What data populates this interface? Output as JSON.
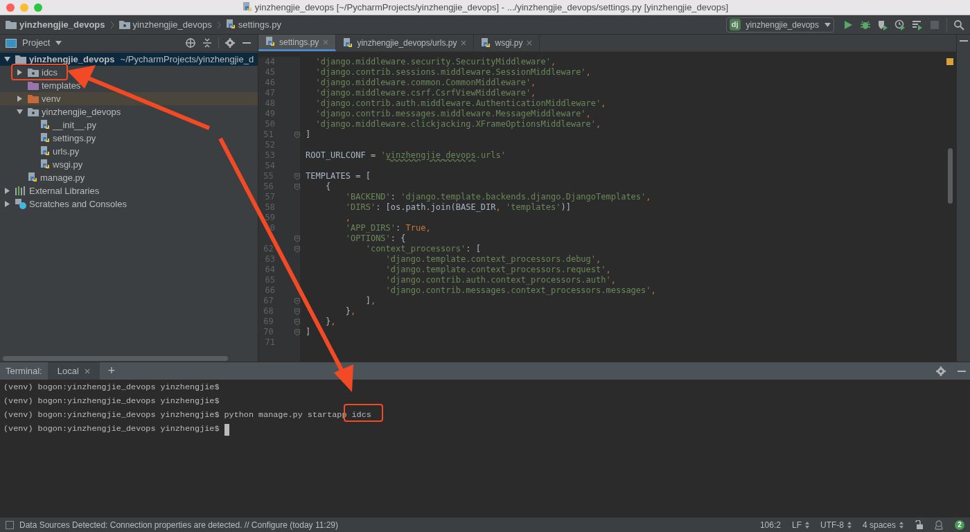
{
  "window": {
    "title": "yinzhengjie_devops [~/PycharmProjects/yinzhengjie_devops] - .../yinzhengjie_devops/settings.py [yinzhengjie_devops]"
  },
  "breadcrumbs": [
    {
      "kind": "project",
      "label": "yinzhengjie_devops"
    },
    {
      "kind": "package",
      "label": "yinzhengjie_devops"
    },
    {
      "kind": "python",
      "label": "settings.py"
    }
  ],
  "run_config": {
    "badge": "dj",
    "label": "yinzhengjie_devops"
  },
  "project_panel": {
    "title": "Project",
    "tree": [
      {
        "kind": "project",
        "label": "yinzhengjie_devops",
        "path": "~/PycharmProjects/yinzhengjie_d",
        "expanded": true,
        "selected": true,
        "children": [
          {
            "kind": "package",
            "label": "idcs",
            "expanded": false,
            "selected": false
          },
          {
            "kind": "templates",
            "label": "templates",
            "selected": false
          },
          {
            "kind": "excluded",
            "label": "venv",
            "expanded": false,
            "selected": false
          },
          {
            "kind": "package",
            "label": "yinzhengjie_devops",
            "expanded": true,
            "selected": false,
            "children": [
              {
                "kind": "python",
                "label": "__init__.py",
                "selected": false
              },
              {
                "kind": "python",
                "label": "settings.py",
                "selected": false
              },
              {
                "kind": "python",
                "label": "urls.py",
                "selected": false
              },
              {
                "kind": "python",
                "label": "wsgi.py",
                "selected": false
              }
            ]
          },
          {
            "kind": "python",
            "label": "manage.py",
            "selected": false
          }
        ]
      },
      {
        "kind": "libraries",
        "label": "External Libraries",
        "expanded": false,
        "selected": false
      },
      {
        "kind": "scratches",
        "label": "Scratches and Consoles",
        "expanded": false,
        "selected": false
      }
    ]
  },
  "editor": {
    "tabs": [
      {
        "label": "settings.py",
        "selected": true
      },
      {
        "label": "yinzhengjie_devops/urls.py",
        "selected": false
      },
      {
        "label": "wsgi.py",
        "selected": false
      }
    ],
    "lines": [
      {
        "number": "44",
        "fold": false,
        "tokens": [
          {
            "kind": "string",
            "text": "  'django.middleware.security.SecurityMiddleware'"
          },
          {
            "kind": "keyword",
            "text": ","
          }
        ]
      },
      {
        "number": "45",
        "fold": false,
        "tokens": [
          {
            "kind": "string",
            "text": "  'django.contrib.sessions.middleware.SessionMiddleware'"
          },
          {
            "kind": "keyword",
            "text": ","
          }
        ]
      },
      {
        "number": "46",
        "fold": false,
        "tokens": [
          {
            "kind": "string",
            "text": "  'django.middleware.common.CommonMiddleware'"
          },
          {
            "kind": "keyword",
            "text": ","
          }
        ]
      },
      {
        "number": "47",
        "fold": false,
        "tokens": [
          {
            "kind": "string",
            "text": "  'django.middleware.csrf.CsrfViewMiddleware'"
          },
          {
            "kind": "keyword",
            "text": ","
          }
        ]
      },
      {
        "number": "48",
        "fold": false,
        "tokens": [
          {
            "kind": "string",
            "text": "  'django.contrib.auth.middleware.AuthenticationMiddleware'"
          },
          {
            "kind": "keyword",
            "text": ","
          }
        ]
      },
      {
        "number": "49",
        "fold": false,
        "tokens": [
          {
            "kind": "string",
            "text": "  'django.contrib.messages.middleware.MessageMiddleware'"
          },
          {
            "kind": "keyword",
            "text": ","
          }
        ]
      },
      {
        "number": "50",
        "fold": false,
        "tokens": [
          {
            "kind": "string",
            "text": "  'django.middleware.clickjacking.XFrameOptionsMiddleware'"
          },
          {
            "kind": "keyword",
            "text": ","
          }
        ]
      },
      {
        "number": "51",
        "fold": true,
        "tokens": [
          {
            "kind": "plain",
            "text": "]"
          }
        ]
      },
      {
        "number": "52",
        "fold": false
      },
      {
        "number": "53",
        "fold": false,
        "tokens": [
          {
            "kind": "plain",
            "text": "ROOT_URLCONF = "
          },
          {
            "kind": "string",
            "text": "'"
          },
          {
            "kind": "typo",
            "text": "yinzhengjie_devops"
          },
          {
            "kind": "string",
            "text": ".urls'"
          }
        ]
      },
      {
        "number": "54",
        "fold": false
      },
      {
        "number": "55",
        "fold": true,
        "tokens": [
          {
            "kind": "plain",
            "text": "TEMPLATES = ["
          }
        ]
      },
      {
        "number": "56",
        "fold": true,
        "tokens": [
          {
            "kind": "plain",
            "text": "    {"
          }
        ]
      },
      {
        "number": "57",
        "fold": false,
        "tokens": [
          {
            "kind": "string",
            "text": "        'BACKEND'"
          },
          {
            "kind": "plain",
            "text": ": "
          },
          {
            "kind": "string",
            "text": "'django.template.backends.django.DjangoTemplates'"
          },
          {
            "kind": "keyword",
            "text": ","
          }
        ]
      },
      {
        "number": "58",
        "fold": false,
        "tokens": [
          {
            "kind": "string",
            "text": "        'DIRS'"
          },
          {
            "kind": "plain",
            "text": ": [os.path.join(BASE_DIR"
          },
          {
            "kind": "keyword",
            "text": ","
          },
          {
            "kind": "string",
            "text": " 'templates'"
          },
          {
            "kind": "plain",
            "text": ")]"
          }
        ]
      },
      {
        "number": "59",
        "fold": false,
        "tokens": [
          {
            "kind": "keyword",
            "text": "        ,"
          }
        ]
      },
      {
        "number": "0",
        "fold": false,
        "tokens": [
          {
            "kind": "string",
            "text": "        'APP_DIRS'"
          },
          {
            "kind": "plain",
            "text": ": "
          },
          {
            "kind": "keyword",
            "text": "True,"
          }
        ]
      },
      {
        "fold": true,
        "tokens": [
          {
            "kind": "string",
            "text": "        'OPTIONS'"
          },
          {
            "kind": "plain",
            "text": ": {"
          }
        ]
      },
      {
        "number": "62",
        "fold": true,
        "tokens": [
          {
            "kind": "string",
            "text": "            'context_processors'"
          },
          {
            "kind": "plain",
            "text": ": ["
          }
        ]
      },
      {
        "number": "63",
        "fold": false,
        "tokens": [
          {
            "kind": "string",
            "text": "                'django.template.context_processors.debug'"
          },
          {
            "kind": "keyword",
            "text": ","
          }
        ]
      },
      {
        "number": "64",
        "fold": false,
        "tokens": [
          {
            "kind": "string",
            "text": "                'django.template.context_processors.request'"
          },
          {
            "kind": "keyword",
            "text": ","
          }
        ]
      },
      {
        "number": "65",
        "fold": false,
        "tokens": [
          {
            "kind": "string",
            "text": "                'django.contrib.auth.context_processors.auth'"
          },
          {
            "kind": "keyword",
            "text": ","
          }
        ]
      },
      {
        "number": "66",
        "fold": false,
        "tokens": [
          {
            "kind": "string",
            "text": "                'django.contrib.messages.context_processors.messages'"
          },
          {
            "kind": "keyword",
            "text": ","
          }
        ]
      },
      {
        "number": "67",
        "fold": true,
        "tokens": [
          {
            "kind": "plain",
            "text": "            ]"
          },
          {
            "kind": "keyword",
            "text": ","
          }
        ]
      },
      {
        "number": "68",
        "fold": true,
        "tokens": [
          {
            "kind": "plain",
            "text": "        }"
          },
          {
            "kind": "keyword",
            "text": ","
          }
        ]
      },
      {
        "number": "69",
        "fold": true,
        "tokens": [
          {
            "kind": "plain",
            "text": "    }"
          },
          {
            "kind": "keyword",
            "text": ","
          }
        ]
      },
      {
        "number": "70",
        "fold": true,
        "tokens": [
          {
            "kind": "plain",
            "text": "]"
          }
        ]
      },
      {
        "number": "71",
        "fold": false
      }
    ]
  },
  "terminal": {
    "title": "Terminal:",
    "tabs": [
      {
        "label": "Local",
        "selected": true
      }
    ],
    "add": "+",
    "lines": [
      {
        "prompt": "(venv) bogon:yinzhengjie_devops yinzhengjie$",
        "cursor": false
      },
      {
        "prompt": "(venv) bogon:yinzhengjie_devops yinzhengjie$",
        "cursor": false
      },
      {
        "prompt": "(venv) bogon:yinzhengjie_devops yinzhengjie$",
        "command": "python manage.py startapp",
        "argument": "idcs",
        "cursor": false
      },
      {
        "prompt": "(venv) bogon:yinzhengjie_devops yinzhengjie$",
        "cursor": true
      }
    ]
  },
  "status_bar": {
    "message": "Data Sources Detected: Connection properties are detected. // Configure (today 11:29)",
    "items": [
      {
        "text": "106:2",
        "chooser": false
      },
      {
        "text": "LF",
        "chooser": true
      },
      {
        "text": "UTF-8",
        "chooser": true
      },
      {
        "text": "4 spaces",
        "chooser": true
      }
    ],
    "notifications": "2"
  }
}
